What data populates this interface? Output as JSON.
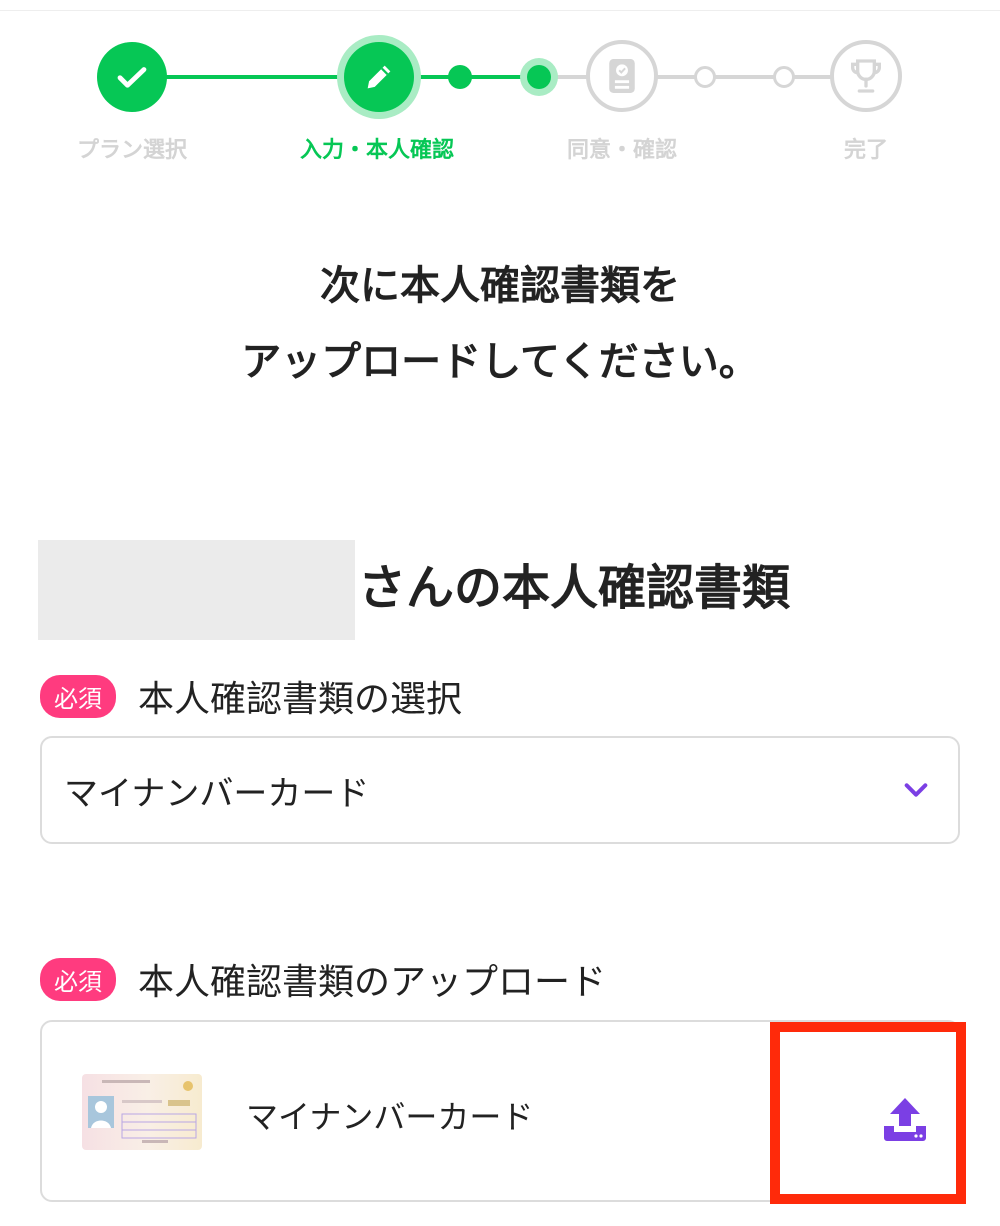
{
  "stepper": {
    "steps": [
      {
        "label": "プラン選択"
      },
      {
        "label": "入力・本人確認"
      },
      {
        "label": "同意・確認"
      },
      {
        "label": "完了"
      }
    ]
  },
  "heading": {
    "line1": "次に本人確認書類を",
    "line2": "アップロードしてください。"
  },
  "applicant": {
    "name_suffix": "さんの本人確認書類"
  },
  "doc_select": {
    "required_badge": "必須",
    "label": "本人確認書類の選択",
    "selected_value": "マイナンバーカード"
  },
  "doc_upload": {
    "required_badge": "必須",
    "label": "本人確認書類のアップロード",
    "file_name": "マイナンバーカード"
  },
  "colors": {
    "primary_green": "#06c755",
    "accent_purple": "#7b3fe4",
    "required_pink": "#ff3b7f",
    "highlight_red": "#ff2a0a"
  },
  "icons": [
    "check-icon",
    "pencil-icon",
    "document-check-icon",
    "trophy-icon",
    "chevron-down-icon",
    "upload-icon"
  ]
}
